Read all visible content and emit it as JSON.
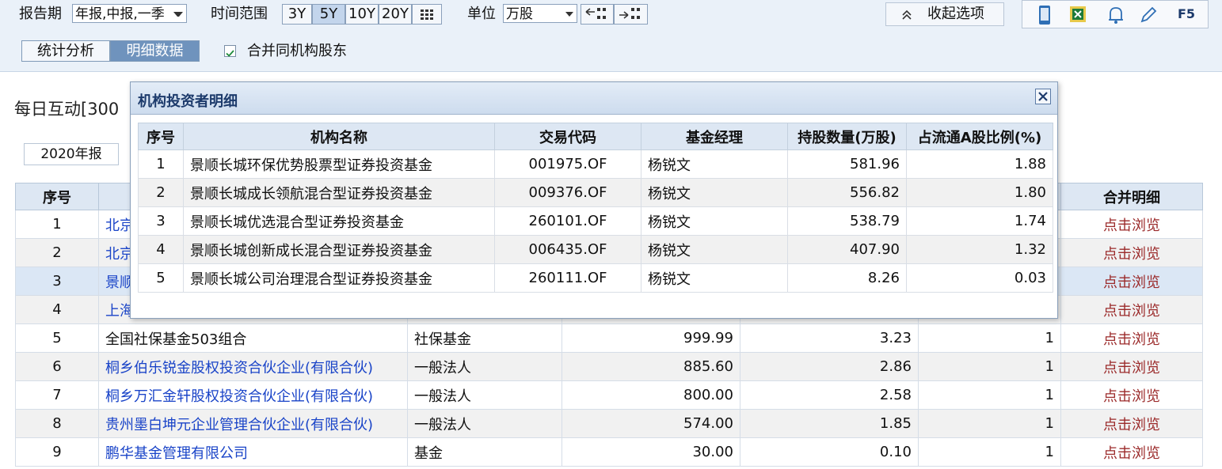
{
  "toolbar": {
    "report_period_label": "报告期",
    "report_period_value": "年报,中报,一季",
    "time_range_label": "时间范围",
    "ranges": [
      "3Y",
      "5Y",
      "10Y",
      "20Y"
    ],
    "active_range": "5Y",
    "unit_label": "单位",
    "unit_value": "万股",
    "collapse_label": "收起选项",
    "f5_label": "F5"
  },
  "view_tabs": [
    "统计分析",
    "明细数据"
  ],
  "active_tab": "明细数据",
  "merge_checkbox": {
    "label": "合并同机构股东",
    "checked": true
  },
  "page": {
    "title": "每日互动[300",
    "period": "2020年报"
  },
  "main_table": {
    "headers": [
      "序号",
      "",
      "",
      "",
      "",
      "",
      "合并明细"
    ],
    "rows": [
      {
        "no": "1",
        "name": "北京",
        "type": "",
        "shares": "",
        "ratio": "",
        "count": "",
        "action": "点击浏览",
        "link": true
      },
      {
        "no": "2",
        "name": "北京",
        "type": "",
        "shares": "",
        "ratio": "",
        "count": "",
        "action": "点击浏览",
        "link": true
      },
      {
        "no": "3",
        "name": "景顺",
        "type": "",
        "shares": "",
        "ratio": "",
        "count": "",
        "action": "点击浏览",
        "link": true
      },
      {
        "no": "4",
        "name": "上海",
        "type": "",
        "shares": "",
        "ratio": "",
        "count": "",
        "action": "点击浏览",
        "link": true
      },
      {
        "no": "5",
        "name": "全国社保基金503组合",
        "type": "社保基金",
        "shares": "999.99",
        "ratio": "3.23",
        "count": "1",
        "action": "点击浏览",
        "link": false
      },
      {
        "no": "6",
        "name": "桐乡伯乐锐金股权投资合伙企业(有限合伙)",
        "type": "一般法人",
        "shares": "885.60",
        "ratio": "2.86",
        "count": "1",
        "action": "点击浏览",
        "link": true
      },
      {
        "no": "7",
        "name": "桐乡万汇金轩股权投资合伙企业(有限合伙)",
        "type": "一般法人",
        "shares": "800.00",
        "ratio": "2.58",
        "count": "1",
        "action": "点击浏览",
        "link": true
      },
      {
        "no": "8",
        "name": "贵州墨白坤元企业管理合伙企业(有限合伙)",
        "type": "一般法人",
        "shares": "574.00",
        "ratio": "1.85",
        "count": "1",
        "action": "点击浏览",
        "link": true
      },
      {
        "no": "9",
        "name": "鹏华基金管理有限公司",
        "type": "基金",
        "shares": "30.00",
        "ratio": "0.10",
        "count": "1",
        "action": "点击浏览",
        "link": true
      }
    ]
  },
  "modal": {
    "title": "机构投资者明细",
    "headers": [
      "序号",
      "机构名称",
      "交易代码",
      "基金经理",
      "持股数量(万股)",
      "占流通A股比例(%)"
    ],
    "rows": [
      {
        "no": "1",
        "name": "景顺长城环保优势股票型证券投资基金",
        "code": "001975.OF",
        "manager": "杨锐文",
        "shares": "581.96",
        "ratio": "1.88"
      },
      {
        "no": "2",
        "name": "景顺长城成长领航混合型证券投资基金",
        "code": "009376.OF",
        "manager": "杨锐文",
        "shares": "556.82",
        "ratio": "1.80"
      },
      {
        "no": "3",
        "name": "景顺长城优选混合型证券投资基金",
        "code": "260101.OF",
        "manager": "杨锐文",
        "shares": "538.79",
        "ratio": "1.74"
      },
      {
        "no": "4",
        "name": "景顺长城创新成长混合型证券投资基金",
        "code": "006435.OF",
        "manager": "杨锐文",
        "shares": "407.90",
        "ratio": "1.32"
      },
      {
        "no": "5",
        "name": "景顺长城公司治理混合型证券投资基金",
        "code": "260111.OF",
        "manager": "杨锐文",
        "shares": "8.26",
        "ratio": "0.03"
      }
    ]
  },
  "icons": [
    "mobile-icon",
    "excel-export-icon",
    "bell-icon",
    "pencil-icon",
    "grid-icon",
    "expand-columns-icon",
    "shrink-columns-icon",
    "chevron-up-icon",
    "close-icon",
    "checkmark-icon"
  ]
}
